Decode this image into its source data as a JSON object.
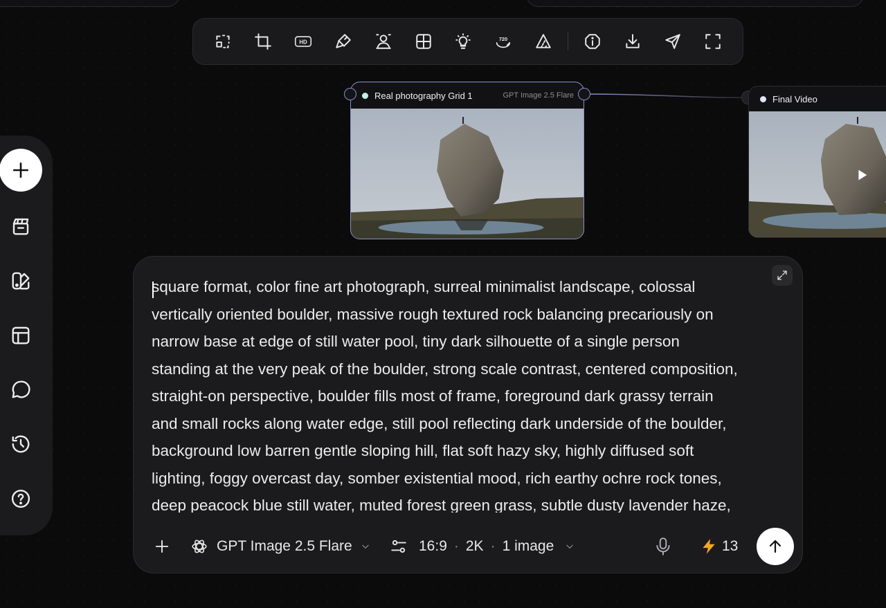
{
  "toolbar": {
    "tools": [
      "select-region-icon",
      "crop-icon",
      "hd-icon",
      "brush-icon",
      "person-cutout-icon",
      "grid-icon",
      "light-bulb-icon",
      "upscale-720-icon",
      "perspective-icon",
      "info-icon",
      "download-icon",
      "send-icon",
      "fullscreen-icon"
    ],
    "hd_label": "HD",
    "res_label": "720"
  },
  "sidebar": {
    "items": [
      "add-icon",
      "clapperboard-icon",
      "palette-icon",
      "layout-icon",
      "chat-icon",
      "history-icon",
      "help-icon"
    ]
  },
  "node_image": {
    "title": "Real photography Grid 1",
    "model": "GPT Image 2.5 Flare"
  },
  "node_video": {
    "title": "Final Video"
  },
  "prompt": {
    "text": "square format, color fine art photograph, surreal minimalist landscape, colossal\nvertically oriented boulder, massive rough textured rock balancing precariously on\nnarrow base at edge of still water pool, tiny dark silhouette of a single person\nstanding at the very peak of the boulder, strong scale contrast, centered composition,\nstraight-on perspective, boulder fills most of frame, foreground dark grassy terrain\nand small rocks along water edge, still pool reflecting dark underside of the boulder,\nbackground low barren gentle sloping hill, flat soft hazy sky, highly diffused soft\nlighting, foggy overcast day, somber existential mood, rich earthy ochre rock tones,\ndeep peacock blue still water, muted forest green grass, subtle dusty lavender haze,"
  },
  "controls": {
    "model": "GPT Image 2.5 Flare",
    "aspect": "16:9",
    "resolution": "2K",
    "count": "1 image",
    "credits": "13"
  },
  "colors": {
    "accent_outline": "#8a90c8",
    "credit_bolt": "#f5a623"
  }
}
